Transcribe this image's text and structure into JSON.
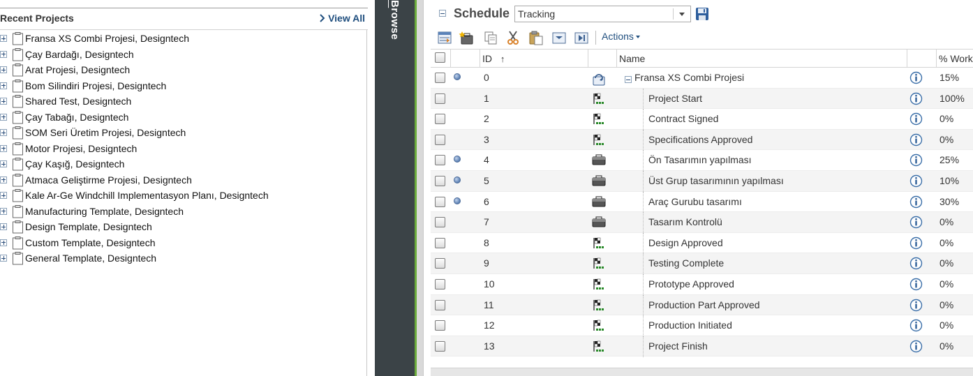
{
  "left_panel": {
    "title": "Recent Projects",
    "view_all": "View All",
    "projects": [
      "Fransa XS Combi Projesi, Designtech",
      "Çay Bardağı, Designtech",
      "Arat Projesi, Designtech",
      "Bom Silindiri Projesi, Designtech",
      "Shared Test, Designtech",
      "Çay Tabağı, Designtech",
      "SOM Seri Üretim Projesi, Designtech",
      "Motor Projesi, Designtech",
      "Çay Kaşığ, Designtech",
      "Atmaca Geliştirme Projesi, Designtech",
      "Kale Ar-Ge Windchill Implementasyon Planı, Designtech",
      "Manufacturing Template, Designtech",
      "Design Template, Designtech",
      "Custom Template, Designtech",
      "General Template, Designtech"
    ]
  },
  "browse": {
    "label": "Browse"
  },
  "schedule": {
    "title": "Schedule",
    "view_selected": "Tracking",
    "actions_label": "Actions",
    "toolbar_icons": [
      "insert-row-icon",
      "new-task-icon",
      "copy-icon",
      "cut-icon",
      "paste-icon",
      "indent-icon",
      "outdent-icon"
    ],
    "columns": {
      "id": "ID",
      "sort_indicator": "↑",
      "name": "Name",
      "work": "% Work"
    },
    "rows": [
      {
        "id": "0",
        "name": "Fransa XS Combi Projesi",
        "work": "15%",
        "status_dot": true,
        "type": "summary",
        "level": 0
      },
      {
        "id": "1",
        "name": "Project Start",
        "work": "100%",
        "status_dot": false,
        "type": "milestone",
        "level": 1
      },
      {
        "id": "2",
        "name": "Contract Signed",
        "work": "0%",
        "status_dot": false,
        "type": "milestone",
        "level": 1
      },
      {
        "id": "3",
        "name": "Specifications Approved",
        "work": "0%",
        "status_dot": false,
        "type": "milestone",
        "level": 1
      },
      {
        "id": "4",
        "name": "Ön Tasarımın yapılması",
        "work": "25%",
        "status_dot": true,
        "type": "task",
        "level": 1
      },
      {
        "id": "5",
        "name": "Üst Grup tasarımının yapılması",
        "work": "10%",
        "status_dot": true,
        "type": "task",
        "level": 1
      },
      {
        "id": "6",
        "name": "Araç Gurubu tasarımı",
        "work": "30%",
        "status_dot": true,
        "type": "task",
        "level": 1
      },
      {
        "id": "7",
        "name": "Tasarım Kontrolü",
        "work": "0%",
        "status_dot": false,
        "type": "task",
        "level": 1
      },
      {
        "id": "8",
        "name": "Design Approved",
        "work": "0%",
        "status_dot": false,
        "type": "milestone",
        "level": 1
      },
      {
        "id": "9",
        "name": "Testing Complete",
        "work": "0%",
        "status_dot": false,
        "type": "milestone",
        "level": 1
      },
      {
        "id": "10",
        "name": "Prototype Approved",
        "work": "0%",
        "status_dot": false,
        "type": "milestone",
        "level": 1
      },
      {
        "id": "11",
        "name": "Production Part Approved",
        "work": "0%",
        "status_dot": false,
        "type": "milestone",
        "level": 1
      },
      {
        "id": "12",
        "name": "Production Initiated",
        "work": "0%",
        "status_dot": false,
        "type": "milestone",
        "level": 1
      },
      {
        "id": "13",
        "name": "Project Finish",
        "work": "0%",
        "status_dot": false,
        "type": "milestone",
        "level": 1
      }
    ]
  },
  "colors": {
    "accent_link": "#1f4e7e",
    "browse_bg": "#3b4347",
    "green_edge": "#6aaa3a"
  }
}
